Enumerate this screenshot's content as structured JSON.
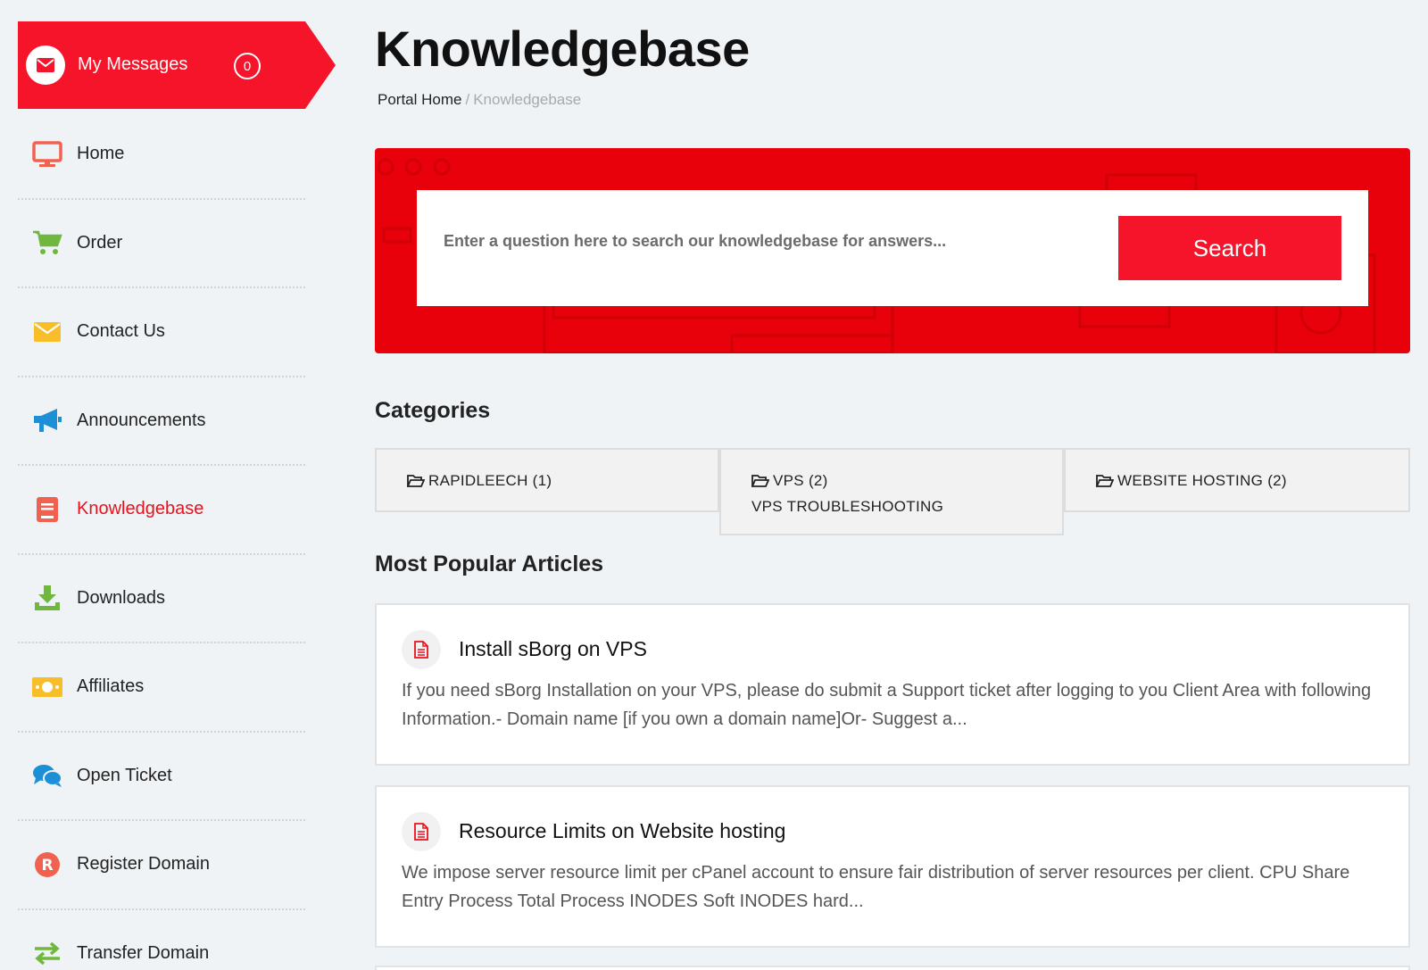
{
  "sidebar": {
    "messages": {
      "label": "My Messages",
      "count": "0"
    },
    "items": [
      {
        "label": "Home",
        "icon": "monitor-icon"
      },
      {
        "label": "Order",
        "icon": "cart-icon"
      },
      {
        "label": "Contact Us",
        "icon": "envelope-icon"
      },
      {
        "label": "Announcements",
        "icon": "megaphone-icon"
      },
      {
        "label": "Knowledgebase",
        "icon": "book-icon",
        "active": true
      },
      {
        "label": "Downloads",
        "icon": "download-icon"
      },
      {
        "label": "Affiliates",
        "icon": "money-icon"
      },
      {
        "label": "Open Ticket",
        "icon": "chat-icon"
      },
      {
        "label": "Register Domain",
        "icon": "registered-icon"
      },
      {
        "label": "Transfer Domain",
        "icon": "transfer-icon"
      }
    ]
  },
  "page": {
    "title": "Knowledgebase",
    "breadcrumb": {
      "home": "Portal Home",
      "separator": "/",
      "current": "Knowledgebase"
    }
  },
  "search": {
    "placeholder": "Enter a question here to search our knowledgebase for answers...",
    "button_label": "Search"
  },
  "categories": {
    "title": "Categories",
    "items": [
      {
        "label": "RAPIDLEECH (1)",
        "description": ""
      },
      {
        "label": "VPS (2)",
        "description": "VPS TROUBLESHOOTING"
      },
      {
        "label": "WEBSITE HOSTING (2)",
        "description": ""
      }
    ]
  },
  "articles": {
    "title": "Most Popular Articles",
    "items": [
      {
        "title": "Install sBorg on VPS",
        "excerpt": "If you need sBorg Installation on your VPS, please do submit a Support ticket after logging to you Client Area with following Information.- Domain name [if you own a domain name]Or- Suggest a..."
      },
      {
        "title": "Resource Limits on Website hosting",
        "excerpt": "We impose server resource limit per cPanel account to ensure fair distribution of server resources per client.   CPU Share Entry Process Total Process INODES Soft INODES hard..."
      }
    ]
  },
  "colors": {
    "accent": "#f5142a",
    "banner": "#e8000a",
    "active_text": "#e8121e"
  }
}
